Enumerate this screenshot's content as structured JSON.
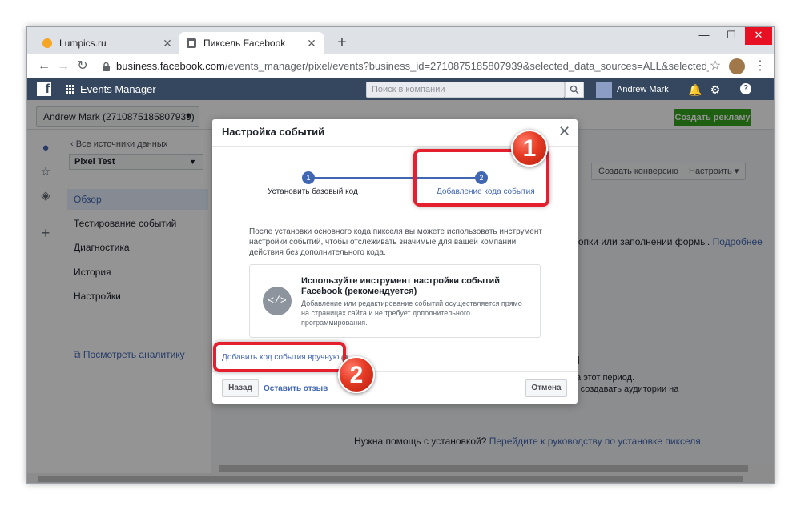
{
  "browser": {
    "tabs": [
      {
        "title": "Lumpics.ru",
        "active": false
      },
      {
        "title": "Пиксель Facebook",
        "active": true
      }
    ],
    "new_tab": "+",
    "url_domain": "business.facebook.com",
    "url_rest": "/events_manager/pixel/events?business_id=2710875185807939&selected_data_sources=ALL&selected_screen_section=DATA_SO..."
  },
  "fb_bar": {
    "logo": "f",
    "title": "Events Manager",
    "search_placeholder": "Поиск в компании",
    "user_name": "Andrew Mark"
  },
  "subbar": {
    "account": "Andrew Mark (2710875185807939)",
    "create_ad": "Создать рекламу"
  },
  "left_nav": {
    "back": "Все источники данных",
    "pixel": "Pixel Test",
    "items": [
      "Обзор",
      "Тестирование событий",
      "Диагностика",
      "История",
      "Настройки"
    ],
    "analytics": "Посмотреть аналитику"
  },
  "main": {
    "create_conversion": "Создать конверсию",
    "configure": "Настроить",
    "text_1": "кнопки или заполнении формы.",
    "text_1_link": "Подробнее",
    "text_2": "й",
    "text_3": "за этот период.",
    "text_4": "м создавать аудитории на",
    "help_text": "Нужна помощь с установкой?",
    "help_link": "Перейдите к руководству по установке пикселя."
  },
  "modal": {
    "title": "Настройка событий",
    "steps": [
      {
        "num": "1",
        "label": "Установить базовый код"
      },
      {
        "num": "2",
        "label": "Добавление кода события"
      }
    ],
    "description": "После установки основного кода пикселя вы можете использовать инструмент настройки событий, чтобы отслеживать значимые для вашей компании действия без дополнительного кода.",
    "card_icon": "</>",
    "card_title": "Используйте инструмент настройки событий Facebook (рекомендуется)",
    "card_desc": "Добавление или редактирование событий осуществляется прямо на страницах сайта и не требует дополнительного программирования.",
    "manual_link": "Добавить код события вручную",
    "back_button": "Назад",
    "feedback": "Оставить отзыв",
    "cancel_button": "Отмена"
  },
  "annotations": {
    "badge_1": "1",
    "badge_2": "2"
  }
}
